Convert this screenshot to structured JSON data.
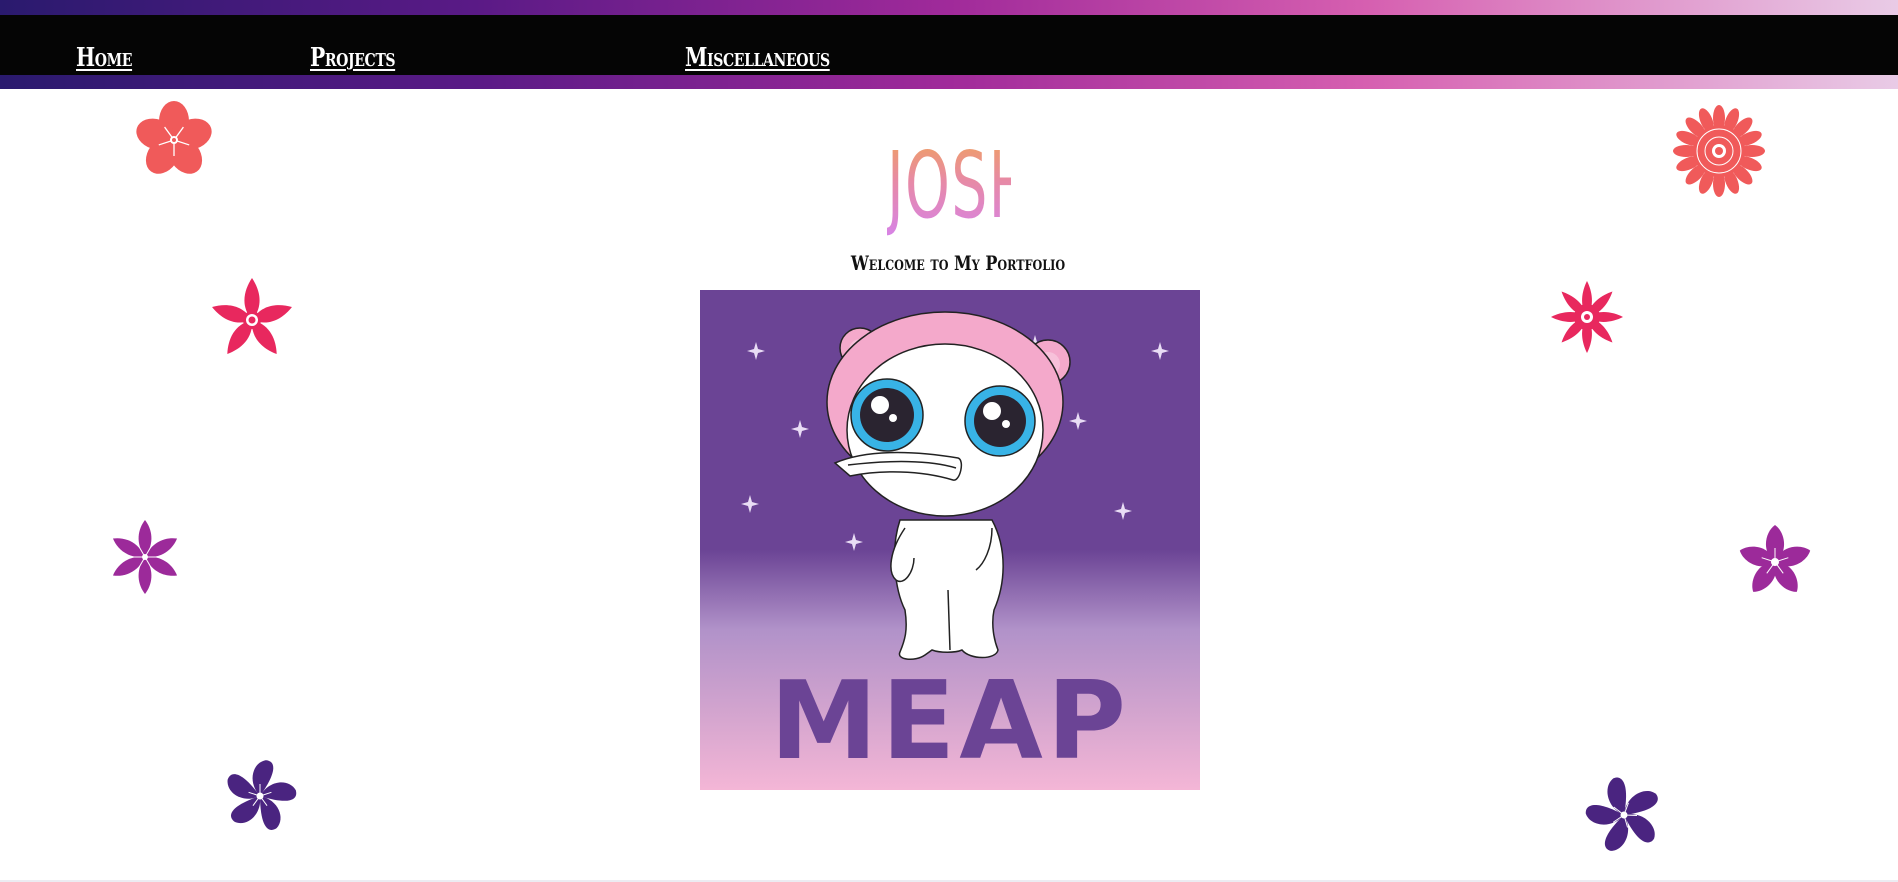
{
  "nav": {
    "home": "Home",
    "projects": "Projects",
    "misc": "Miscellaneous"
  },
  "header": {
    "title": "JOSH",
    "subtitle": "Welcome to My Portfolio"
  },
  "hero": {
    "logo_text": "MEAP"
  },
  "colors": {
    "navbar": "#050505",
    "gradient_start": "#2a1a6e",
    "gradient_end": "#e9cbe6",
    "flower_coral": "#f05a5a",
    "flower_pink": "#e8285e",
    "flower_magenta": "#9c2a9a",
    "flower_indigo": "#4a2480",
    "hero_purple": "#6b4495"
  },
  "icons": [
    "coral-flower-icon",
    "pink-flower-icon",
    "magenta-flower-icon",
    "indigo-flower-icon",
    "meap-character-icon"
  ]
}
